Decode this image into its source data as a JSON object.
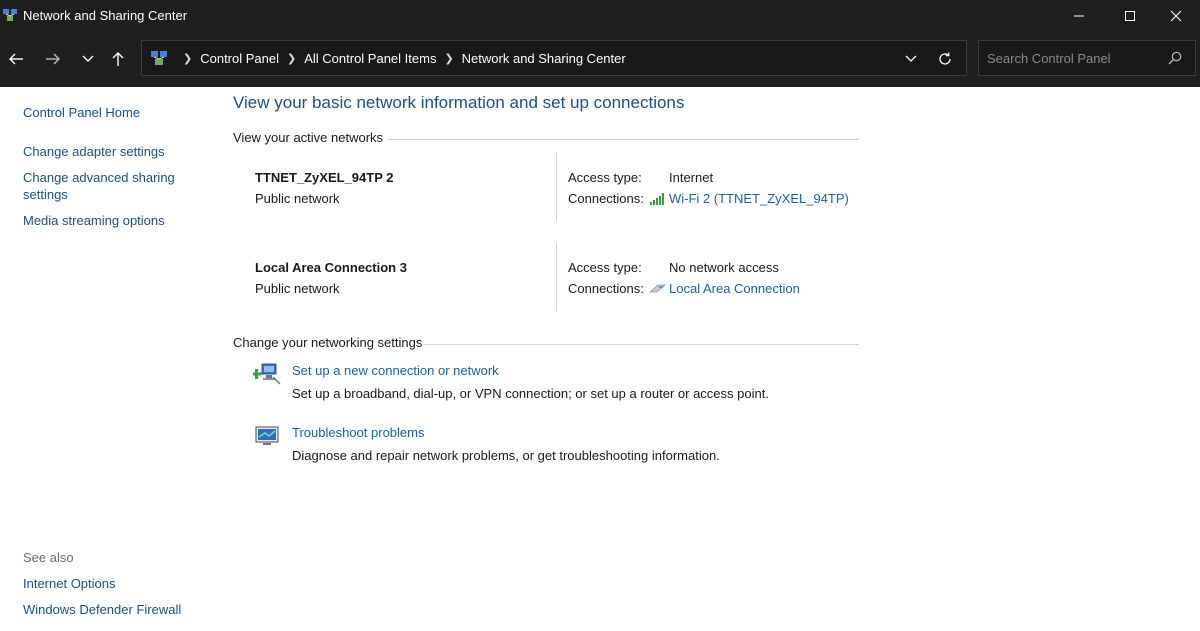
{
  "window": {
    "title": "Network and Sharing Center"
  },
  "navbar": {
    "breadcrumbs": [
      "Control Panel",
      "All Control Panel Items",
      "Network and Sharing Center"
    ],
    "search_placeholder": "Search Control Panel"
  },
  "sidebar": {
    "home": "Control Panel Home",
    "links": [
      "Change adapter settings",
      "Change advanced sharing settings",
      "Media streaming options"
    ],
    "see_also_label": "See also",
    "see_also": [
      "Internet Options",
      "Windows Defender Firewall"
    ]
  },
  "main": {
    "title": "View your basic network information and set up connections",
    "active_networks_heading": "View your active networks",
    "networks": [
      {
        "name": "TTNET_ZyXEL_94TP 2",
        "category": "Public network",
        "access_type_label": "Access type:",
        "access_type": "Internet",
        "connections_label": "Connections:",
        "connection": "Wi-Fi 2 (TTNET_ZyXEL_94TP)",
        "connection_icon": "wifi-signal-icon"
      },
      {
        "name": "Local Area Connection 3",
        "category": "Public network",
        "access_type_label": "Access type:",
        "access_type": "No network access",
        "connections_label": "Connections:",
        "connection": "Local Area Connection",
        "connection_icon": "ethernet-cable-icon"
      }
    ],
    "settings_heading": "Change your networking settings",
    "tasks": [
      {
        "link": "Set up a new connection or network",
        "description": "Set up a broadband, dial-up, or VPN connection; or set up a router or access point.",
        "icon": "new-connection-icon"
      },
      {
        "link": "Troubleshoot problems",
        "description": "Diagnose and repair network problems, or get troubleshooting information.",
        "icon": "troubleshoot-icon"
      }
    ]
  },
  "colors": {
    "chrome_bg": "#1f1f1f",
    "link": "#1a5fb4",
    "title": "#1e4e8c"
  }
}
